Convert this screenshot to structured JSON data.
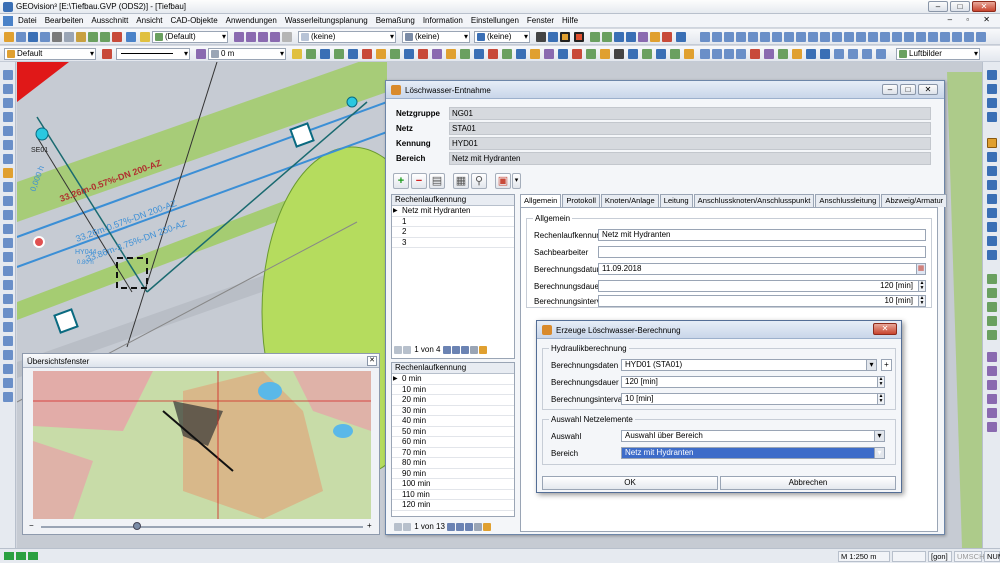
{
  "window": {
    "title": "GEOvision³ [E:\\Tiefbau.GVP (ODS2)] - [Tiefbau]",
    "controls": [
      "–",
      "□",
      "✕"
    ]
  },
  "menu": {
    "items": [
      "Datei",
      "Bearbeiten",
      "Ausschnitt",
      "Ansicht",
      "CAD-Objekte",
      "Anwendungen",
      "Wasserleitungsplanung",
      "Bemaßung",
      "Information",
      "Einstellungen",
      "Fenster",
      "Hilfe"
    ],
    "mdi_controls": "– ▫ ✕"
  },
  "toolbar1": {
    "layer_combo": "(Default)",
    "style_combo_1": "(keine)",
    "style_combo_2": "(keine)",
    "style_combo_3": "(keine)"
  },
  "toolbar2": {
    "default_combo": "Default",
    "width_combo": "0 m",
    "luftbilder_combo": "Luftbilder"
  },
  "map": {
    "labels": {
      "pipe_1": "33.26m-0.57%-DN 200-AZ",
      "pipe_2": "33.26m-0.57%-DN 200-AZ",
      "pipe_3": "33.86m-3.75%-DN 250-AZ",
      "node_1": "SE01",
      "node_2": "HY044",
      "node_3": "0.80 h",
      "node_4": "0,000 h"
    }
  },
  "overview": {
    "title": "Übersichtsfenster",
    "slider_minus": "−",
    "slider_plus": "+"
  },
  "main_dialog": {
    "title": "Löschwasser-Entnahme",
    "header": [
      {
        "label": "Netzgruppe",
        "value": "NG01"
      },
      {
        "label": "Netz",
        "value": "STA01"
      },
      {
        "label": "Kennung",
        "value": "HYD01"
      },
      {
        "label": "Bereich",
        "value": "Netz mit Hydranten"
      }
    ],
    "list1": {
      "header": "Rechenlaufkennung",
      "rows": [
        "Netz mit Hydranten",
        "1",
        "2",
        "3"
      ],
      "pager": "1 von 4"
    },
    "list2": {
      "header": "Rechenlaufkennung",
      "rows": [
        "0 min",
        "10 min",
        "20 min",
        "30 min",
        "40 min",
        "50 min",
        "60 min",
        "70 min",
        "80 min",
        "90 min",
        "100 min",
        "110 min",
        "120 min"
      ],
      "pager": "1 von 13"
    },
    "tabs": [
      "Allgemein",
      "Protokoll",
      "Knoten/Anlage",
      "Leitung",
      "Anschlussknoten/Anschlusspunkt",
      "Anschlussleitung",
      "Abzweig/Armatur"
    ],
    "general": {
      "group_title": "Allgemein",
      "fields": [
        {
          "label": "Rechenlaufkennung",
          "value": "Netz mit Hydranten"
        },
        {
          "label": "Sachbearbeiter",
          "value": ""
        },
        {
          "label": "Berechnungsdatum",
          "value": "11.09.2018"
        },
        {
          "label": "Berechnungsdauer",
          "value": "120 [min]"
        },
        {
          "label": "Berechnungsintervall",
          "value": "10 [min]"
        }
      ]
    }
  },
  "calc_dialog": {
    "title": "Erzeuge Löschwasser-Berechnung",
    "close_label": "✕",
    "hydraulic_group": "Hydraulikberechnung",
    "hydraulic_fields": [
      {
        "label": "Berechnungsdaten",
        "value": "HYD01 (STA01)"
      },
      {
        "label": "Berechnungsdauer",
        "value": "120 [min]"
      },
      {
        "label": "Berechnungsintervall",
        "value": "10 [min]"
      }
    ],
    "selection_group": "Auswahl Netzelemente",
    "selection_fields": [
      {
        "label": "Auswahl",
        "value": "Auswahl über Bereich"
      },
      {
        "label": "Bereich",
        "value": "Netz mit Hydranten"
      }
    ],
    "ok_label": "OK",
    "cancel_label": "Abbrechen"
  },
  "statusbar": {
    "scale": "M 1:250",
    "unit": "m",
    "gon": "[gon]",
    "umsch": "UMSCH",
    "num": "NUM"
  },
  "colors": {
    "pipe_blue": "#3b8fd6",
    "pipe_red": "#d94a3a",
    "green_area": "#9ccc5a",
    "selected_row": "#3d6cc9"
  }
}
